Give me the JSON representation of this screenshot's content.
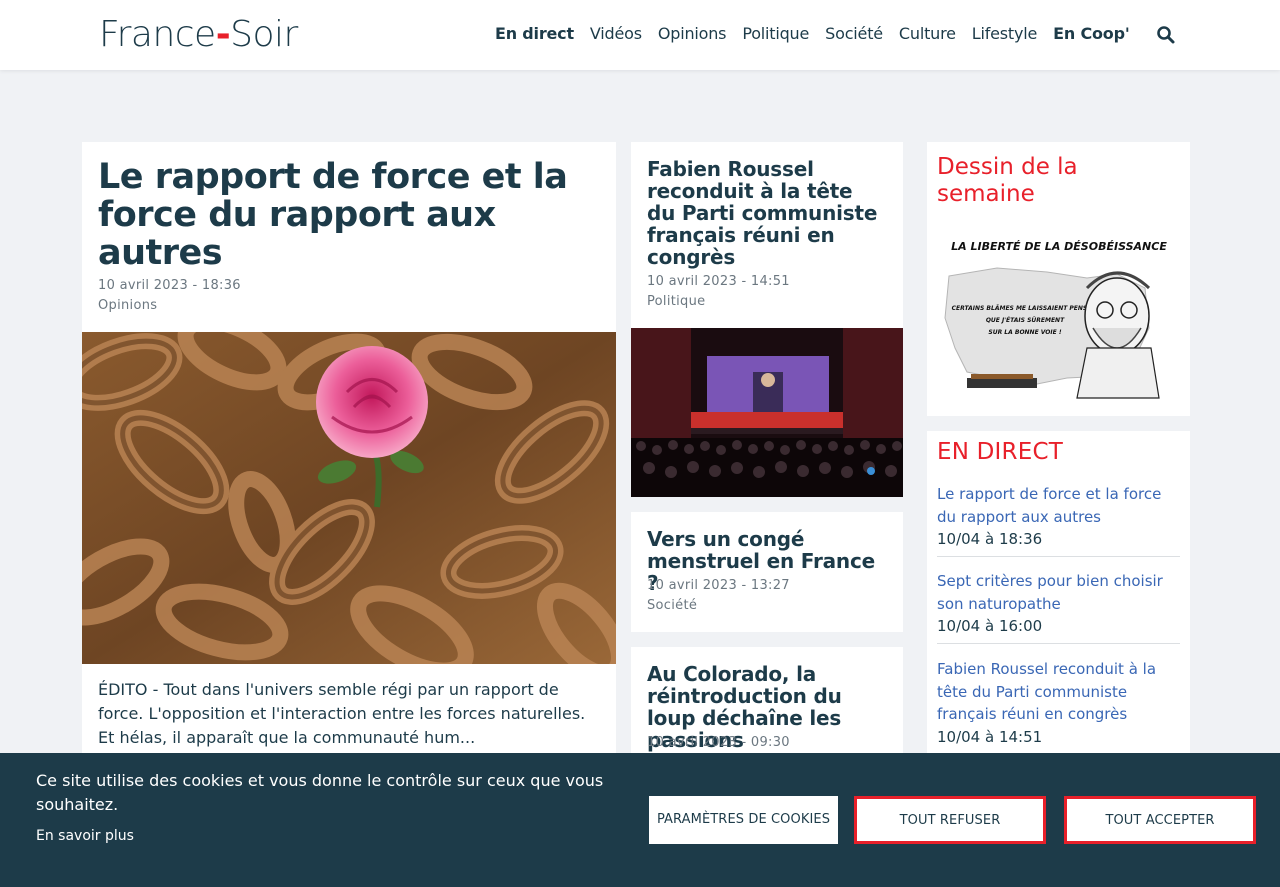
{
  "header": {
    "logo_left": "France",
    "logo_dash": "-",
    "logo_right": "Soir",
    "nav": [
      "En direct",
      "Vidéos",
      "Opinions",
      "Politique",
      "Société",
      "Culture",
      "Lifestyle",
      "En Coop'"
    ],
    "search_icon": "search-icon"
  },
  "main_article": {
    "title": "Le rapport de force et la force du rapport aux autres",
    "date": "10 avril 2023 - 18:36",
    "category": "Opinions",
    "image": "rose-among-rusty-chains",
    "excerpt": "ÉDITO - Tout dans l'univers semble régi par un rapport de force. L'opposition et l'interaction entre les forces naturelles. Et hélas, il apparaît que la communauté hum..."
  },
  "articles": [
    {
      "title": "Fabien Roussel reconduit à la tête du Parti communiste français réuni en congrès",
      "date": "10 avril 2023 - 14:51",
      "category": "Politique",
      "image": "congress-stage-photo"
    },
    {
      "title": "Vers un congé menstruel en France ?",
      "date": "10 avril 2023 - 13:27",
      "category": "Société"
    },
    {
      "title": "Au Colorado, la réintroduction du loup déchaîne les passions",
      "date": "10 avril 2023 - 09:30"
    }
  ],
  "sidebar": {
    "cartoon_heading": "Dessin de la semaine",
    "cartoon_title": "LA LIBERTÉ DE LA DÉSOBÉISSANCE",
    "cartoon_bubble": [
      "CERTAINS BLÂMES ME LAISSAIENT PENSER,",
      "QUE J'ÉTAIS SÛREMENT",
      "SUR LA BONNE VOIE !"
    ],
    "live_heading": "EN DIRECT",
    "live_items": [
      {
        "title": "Le rapport de force et la force du rapport aux autres",
        "time": "10/04 à 18:36"
      },
      {
        "title": "Sept critères pour bien choisir son naturopathe",
        "time": "10/04 à 16:00"
      },
      {
        "title": "Fabien Roussel reconduit à la tête du Parti communiste français réuni en congrès",
        "time": "10/04 à 14:51"
      }
    ]
  },
  "cookies": {
    "text": "Ce site utilise des cookies et vous donne le contrôle sur ceux que vous souhaitez.",
    "more": "En savoir plus",
    "params": "PARAMÈTRES DE COOKIES",
    "refuse": "TOUT REFUSER",
    "accept": "TOUT ACCEPTER"
  },
  "colors": {
    "brand_dark": "#1d3b49",
    "brand_red": "#e8202a",
    "link_blue": "#3a67b5",
    "page_bg": "#f0f2f5"
  }
}
